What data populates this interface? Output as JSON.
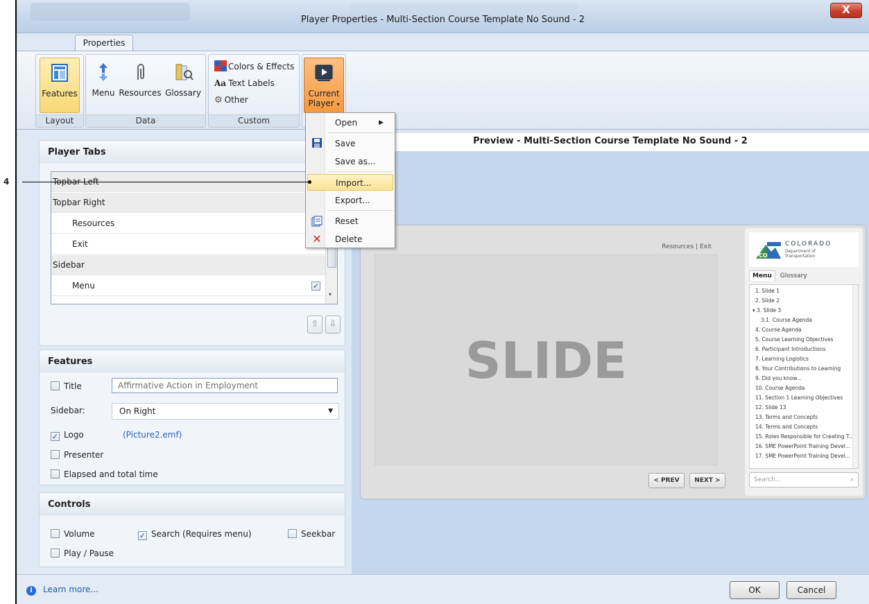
{
  "window": {
    "title": "Player Properties - Multi-Section Course Template No Sound - 2",
    "close_label": "X"
  },
  "ribbon": {
    "tab": "Properties",
    "groups": {
      "layout": {
        "label": "Layout",
        "features": "Features"
      },
      "data": {
        "label": "Data",
        "menu": "Menu",
        "resources": "Resources",
        "glossary": "Glossary"
      },
      "custom": {
        "label": "Custom",
        "colors_effects": "Colors & Effects",
        "text_labels": "Text Labels",
        "text_labels_icon": "Aa",
        "other": "Other"
      },
      "player": {
        "current_player_line1": "Current",
        "current_player_line2": "Player"
      }
    }
  },
  "dropdown": {
    "items": [
      "Open",
      "Save",
      "Save as...",
      "Import...",
      "Export...",
      "Reset",
      "Delete"
    ],
    "highlighted": "Import..."
  },
  "callout": {
    "number": "4"
  },
  "player_tabs": {
    "title": "Player Tabs",
    "rows": [
      {
        "label": "Topbar Left",
        "type": "group"
      },
      {
        "label": "Topbar Right",
        "type": "group"
      },
      {
        "label": "Resources",
        "type": "child"
      },
      {
        "label": "Exit",
        "type": "child"
      },
      {
        "label": "Sidebar",
        "type": "group"
      },
      {
        "label": "Menu",
        "type": "child",
        "checked": true
      }
    ]
  },
  "features": {
    "title": "Features",
    "title_label": "Title",
    "title_value": "Affirmative Action in Employment",
    "title_checked": false,
    "sidebar_label": "Sidebar:",
    "sidebar_value": "On Right",
    "logo_label": "Logo",
    "logo_checked": true,
    "logo_file": "(Picture2.emf)",
    "presenter_label": "Presenter",
    "elapsed_label": "Elapsed and total time"
  },
  "controls": {
    "title": "Controls",
    "volume": "Volume",
    "search": "Search (Requires menu)",
    "search_checked": true,
    "seekbar": "Seekbar",
    "play_pause": "Play / Pause"
  },
  "preview": {
    "header": "Preview - Multi-Section Course Template No Sound - 2",
    "slide_text": "SLIDE",
    "topbar_links": "Resources   |   Exit",
    "prev": "< PREV",
    "next": "NEXT >",
    "logo_title": "COLORADO",
    "logo_sub1": "Department of",
    "logo_sub2": "Transportation",
    "logo_badge": "CO",
    "menu_tab": "Menu",
    "glossary_tab": "Glossary",
    "search_placeholder": "Search...",
    "menu_items": [
      "1. Slide 1",
      "2. Slide 2",
      "▾ 3. Slide 3",
      "3.1. Course Agenda",
      "4. Course Agenda",
      "5. Course Learning Objectives",
      "6. Participant Introductions",
      "7. Learning Logistics",
      "8. Your Contributions to Learning",
      "9. Did you know...",
      "10. Course Agenda",
      "11. Section 1 Learning Objectives",
      "12. Slide 13",
      "13. Terms and Concepts",
      "14. Terms and Concepts",
      "15. Roles Responsible for Creating T...",
      "16. SME PowerPoint Training Devel...",
      "17. SME PowerPoint Training Devel..."
    ]
  },
  "bottom": {
    "learn_more": "Learn more...",
    "ok": "OK",
    "cancel": "Cancel"
  },
  "colors": {
    "accent_selected": "#f7d978",
    "current_player": "#f49a3f",
    "close_button": "#c8412b",
    "preview_bg": "#c5d7ec"
  }
}
